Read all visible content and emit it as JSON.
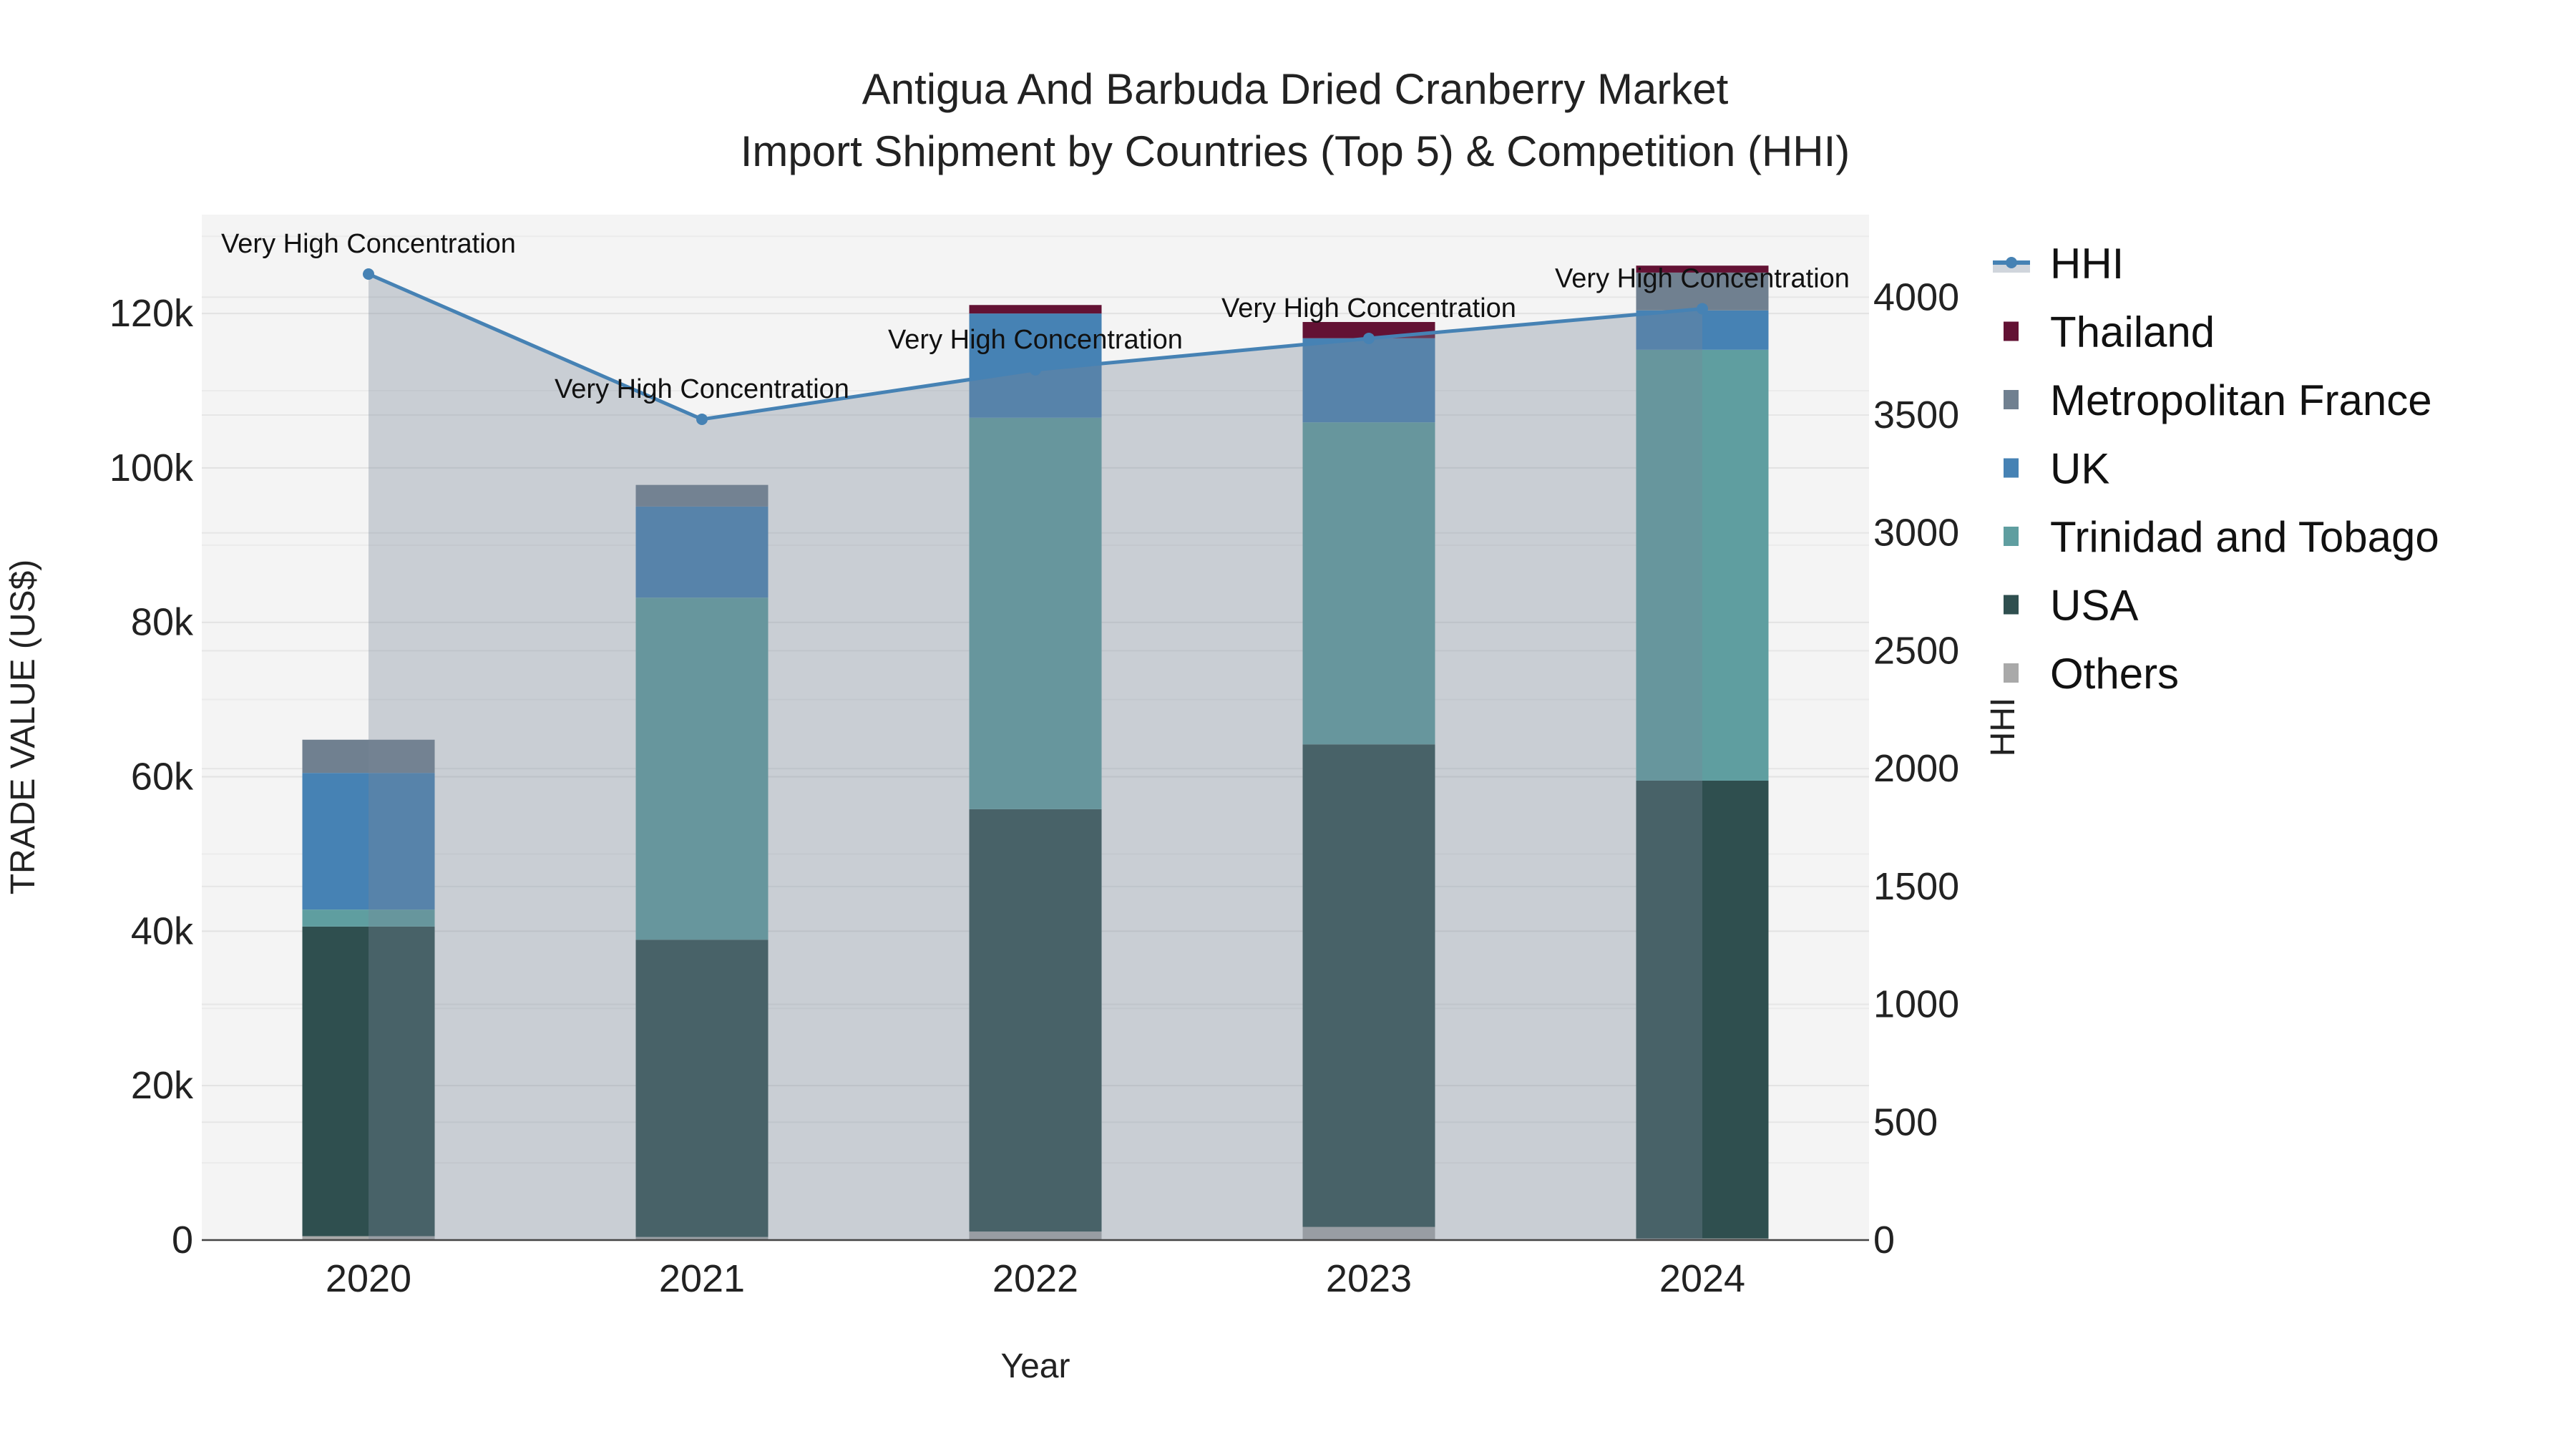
{
  "chart_data": {
    "type": "bar",
    "stacked": true,
    "title": "Antigua And Barbuda Dried Cranberry Market",
    "subtitle": "Import Shipment by Countries (Top 5) & Competition (HHI)",
    "xlabel": "Year",
    "ylabel": "TRADE VALUE (US$)",
    "y2label": "HHI",
    "categories": [
      "2020",
      "2021",
      "2022",
      "2023",
      "2024"
    ],
    "ylim": [
      0,
      132800
    ],
    "y2lim": [
      0,
      4350
    ],
    "yticks": [
      0,
      20000,
      40000,
      60000,
      80000,
      100000,
      120000
    ],
    "ytick_labels": [
      "0",
      "20k",
      "40k",
      "60k",
      "80k",
      "100k",
      "120k"
    ],
    "y2ticks": [
      0,
      500,
      1000,
      1500,
      2000,
      2500,
      3000,
      3500,
      4000
    ],
    "y2tick_labels": [
      "0",
      "500",
      "1000",
      "1500",
      "2000",
      "2500",
      "3000",
      "3500",
      "4000"
    ],
    "grid": true,
    "legend_position": "right",
    "series": [
      {
        "name": "Others",
        "color": "#a9a9a9",
        "values": [
          500,
          400,
          1100,
          1700,
          200
        ]
      },
      {
        "name": "USA",
        "color": "#2f4f4f",
        "values": [
          40100,
          38500,
          54700,
          62500,
          59300
        ]
      },
      {
        "name": "Trinidad and Tobago",
        "color": "#5f9ea0",
        "values": [
          2200,
          44300,
          50700,
          41700,
          55800
        ]
      },
      {
        "name": "UK",
        "color": "#4682b4",
        "values": [
          17700,
          11800,
          13500,
          10900,
          5100
        ]
      },
      {
        "name": "Metropolitan France",
        "color": "#708090",
        "values": [
          4300,
          2800,
          0,
          0,
          4900
        ]
      },
      {
        "name": "Thailand",
        "color": "#631234",
        "values": [
          0,
          0,
          1100,
          2100,
          900
        ]
      }
    ],
    "legend_order": [
      "HHI",
      "Thailand",
      "Metropolitan France",
      "UK",
      "Trinidad and Tobago",
      "USA",
      "Others"
    ],
    "hhi": {
      "name": "HHI",
      "color": "#4682b4",
      "fill": "#778899",
      "values": [
        4098,
        3482,
        3692,
        3825,
        3951
      ],
      "annotations": [
        "Very High Concentration",
        "Very High Concentration",
        "Very High Concentration",
        "Very High Concentration",
        "Very High Concentration"
      ]
    }
  }
}
